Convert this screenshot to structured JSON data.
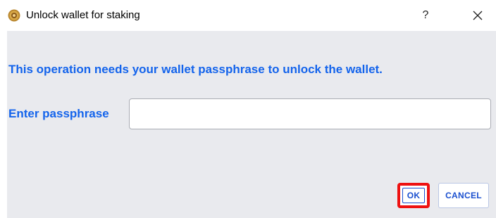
{
  "window": {
    "title": "Unlock wallet for staking",
    "help_label": "?",
    "icon": "wallet-app-icon",
    "close_icon": "close-icon"
  },
  "dialog": {
    "message": "This operation needs your wallet passphrase to unlock the wallet.",
    "passphrase_label": "Enter passphrase",
    "passphrase_value": "",
    "passphrase_placeholder": ""
  },
  "buttons": {
    "ok_label": "OK",
    "cancel_label": "CANCEL"
  },
  "colors": {
    "accent_text": "#1464ec",
    "content_background": "#e9eaee",
    "highlight_border": "#ee1111",
    "button_text": "#1a4fcf"
  }
}
